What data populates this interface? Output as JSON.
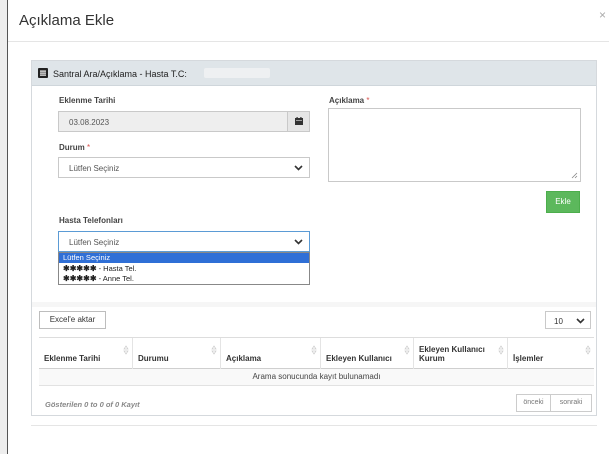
{
  "modal": {
    "title": "Açıklama Ekle",
    "close_label": "×"
  },
  "panel": {
    "title": "Santral Ara/Açıklama - Hasta T.C:"
  },
  "form": {
    "date_label": "Eklenme Tarihi",
    "date_value": "03.08.2023",
    "status_label": "Durum",
    "status_value": "Lütfen Seçiniz",
    "required_mark": "*",
    "description_label": "Açıklama",
    "phones_label": "Hasta Telefonları",
    "phones_value": "Lütfen Seçiniz",
    "add_button": "Ekle"
  },
  "phones_dropdown": {
    "options": [
      {
        "mask": "",
        "label": "Lütfen Seçiniz",
        "selected": true
      },
      {
        "mask": "✱✱✱✱✱",
        "label": " - Hasta Tel."
      },
      {
        "mask": "✱✱✱✱✱",
        "label": " - Anne Tel."
      }
    ]
  },
  "table": {
    "excel_button": "Excel'e aktar",
    "page_size": "10",
    "columns": [
      "Eklenme Tarihi",
      "Durumu",
      "Açıklama",
      "Ekleyen Kullanıcı",
      "Ekleyen Kullanıcı Kurum",
      "İşlemler"
    ],
    "empty_text": "Arama sonucunda kayıt bulunamadı",
    "info_text": "Gösterilen 0 to 0 of 0 Kayıt",
    "prev_button": "önceki",
    "next_button": "sonraki"
  },
  "colors": {
    "add_button": "#5cb85c",
    "selected_option": "#2f6fd6",
    "panel_heading": "#dfe5e9"
  }
}
